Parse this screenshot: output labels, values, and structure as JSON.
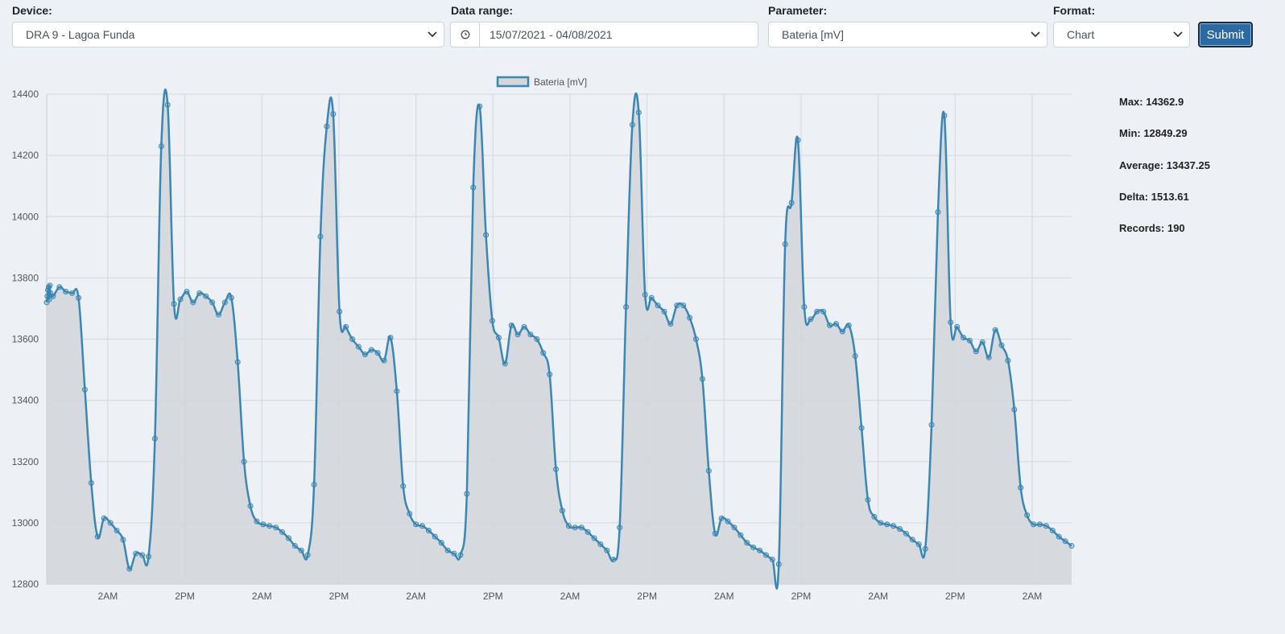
{
  "form": {
    "device_label": "Device:",
    "device_value": "DRA 9 - Lagoa Funda",
    "range_label": "Data range:",
    "range_value": "15/07/2021 - 04/08/2021",
    "parameter_label": "Parameter:",
    "parameter_value": "Bateria [mV]",
    "format_label": "Format:",
    "format_value": "Chart",
    "submit_label": "Submit"
  },
  "stats": {
    "max": "Max: 14362.9",
    "min": "Min: 12849.29",
    "average": "Average: 13437.25",
    "delta": "Delta: 1513.61",
    "records": "Records: 190"
  },
  "colors": {
    "line": "#3a87b5",
    "fill": "#d3d6da",
    "grid": "#d5d9de",
    "submit": "#2b6aa3"
  },
  "chart_data": {
    "type": "area",
    "legend": "Bateria [mV]",
    "legend_position": "top-center",
    "ylim": [
      12800,
      14400
    ],
    "yticks": [
      12800,
      13000,
      13200,
      13400,
      13600,
      13800,
      14000,
      14200,
      14400
    ],
    "xtick_labels": [
      "2AM",
      "2PM",
      "2AM",
      "2PM",
      "2AM",
      "2PM",
      "2AM",
      "2PM",
      "2AM",
      "2PM",
      "2AM",
      "2PM",
      "2AM"
    ],
    "grid": true,
    "x_unit": "hours_from_start",
    "x_max": 161,
    "x": [
      0,
      0.1,
      0.2,
      0.3,
      0.4,
      0.5,
      0.6,
      1,
      2,
      3,
      4,
      5,
      6,
      7,
      8,
      9,
      10,
      11,
      12,
      13,
      14,
      15,
      16,
      17,
      18,
      19,
      20,
      21,
      22,
      23,
      24,
      25,
      26,
      27,
      28,
      29,
      30,
      31,
      32,
      33,
      34,
      35,
      36,
      37,
      38,
      39,
      40,
      41,
      42,
      43,
      44,
      45,
      46,
      47,
      48,
      49,
      50,
      51,
      52,
      53,
      54,
      55,
      56,
      57,
      58,
      59,
      60,
      61,
      62,
      63,
      64,
      65,
      66,
      67,
      68,
      69,
      70,
      71,
      72,
      73,
      74,
      75,
      76,
      77,
      78,
      79,
      80,
      81,
      82,
      83,
      84,
      85,
      86,
      87,
      88,
      89,
      90,
      91,
      92,
      93,
      94,
      95,
      96,
      97,
      98,
      99,
      100,
      101,
      102,
      103,
      104,
      105,
      106,
      107,
      108,
      109,
      110,
      111,
      112,
      113,
      114,
      115,
      116,
      117,
      118,
      119,
      120,
      121,
      122,
      123,
      124,
      125,
      126,
      127,
      128,
      129,
      130,
      131,
      132,
      133,
      134,
      135,
      136,
      137,
      138,
      139,
      140,
      141,
      142,
      143,
      144,
      145,
      146,
      147,
      148,
      149,
      150,
      151,
      152,
      153,
      154,
      155,
      156,
      157,
      158,
      159,
      160,
      161
    ],
    "y": [
      13720,
      13740,
      13760,
      13770,
      13730,
      13775,
      13750,
      13740,
      13770,
      13755,
      13750,
      13735,
      13435,
      13130,
      12955,
      13015,
      13000,
      12975,
      12945,
      12850,
      12900,
      12895,
      12890,
      13275,
      14230,
      14365,
      13715,
      13730,
      13755,
      13720,
      13750,
      13740,
      13720,
      13680,
      13720,
      13735,
      13525,
      13200,
      13055,
      13005,
      12995,
      12990,
      12985,
      12970,
      12950,
      12925,
      12910,
      12895,
      13125,
      13935,
      14295,
      14335,
      13690,
      13640,
      13600,
      13575,
      13550,
      13565,
      13555,
      13530,
      13605,
      13430,
      13120,
      13030,
      12995,
      12990,
      12975,
      12955,
      12935,
      12910,
      12900,
      12895,
      13095,
      14095,
      14360,
      13940,
      13660,
      13605,
      13520,
      13645,
      13615,
      13640,
      13615,
      13600,
      13555,
      13485,
      13175,
      13040,
      12990,
      12985,
      12985,
      12970,
      12950,
      12930,
      12910,
      12880,
      12985,
      13705,
      14300,
      14340,
      13745,
      13735,
      13710,
      13690,
      13650,
      13710,
      13710,
      13670,
      13600,
      13470,
      13170,
      12965,
      13015,
      13005,
      12985,
      12960,
      12935,
      12920,
      12910,
      12895,
      12880,
      12865,
      13910,
      14045,
      14250,
      13705,
      13665,
      13690,
      13690,
      13645,
      13650,
      13625,
      13645,
      13545,
      13310,
      13075,
      13020,
      13000,
      12995,
      12990,
      12980,
      12965,
      12945,
      12930,
      12915,
      13320,
      14015,
      14330,
      13655,
      13640,
      13605,
      13595,
      13560,
      13590,
      13540,
      13630,
      13580,
      13530,
      13370,
      13115,
      13025,
      12995,
      12995,
      12990,
      12975,
      12955,
      12940,
      12925,
      12910,
      13135
    ]
  }
}
